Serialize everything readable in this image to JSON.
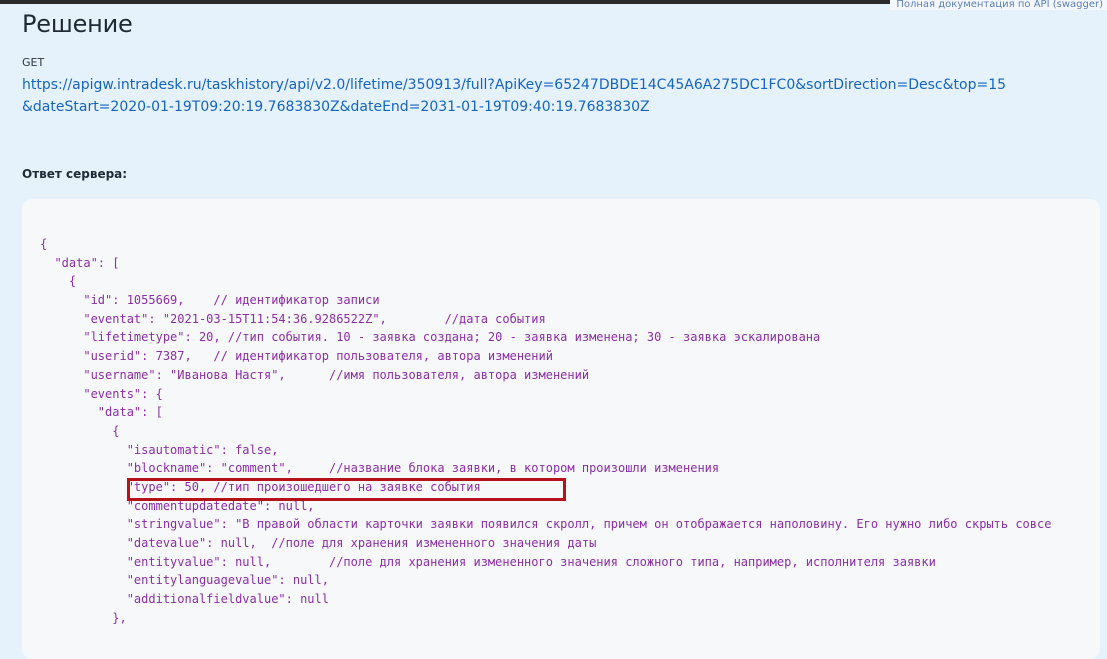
{
  "header": {
    "doc_link": "Полная документация по API (swagger)"
  },
  "section": {
    "title": "Решение",
    "method": "GET",
    "url": "https://apigw.intradesk.ru/taskhistory/api/v2.0/lifetime/350913/full?ApiKey=65247DBDE14C45A6A275DC1FC0&sortDirection=Desc&top=15&dateStart=2020-01-19T09:20:19.7683830Z&dateEnd=2031-01-19T09:40:19.7683830Z",
    "response_label": "Ответ сервера:"
  },
  "code": {
    "lines": [
      "{",
      "  \"data\": [",
      "    {",
      "      \"id\": 1055669,    // идентификатор записи",
      "      \"eventat\": \"2021-03-15T11:54:36.9286522Z\",        //дата события",
      "      \"lifetimetype\": 20, //тип события. 10 - заявка создана; 20 - заявка изменена; 30 - заявка эскалирована",
      "      \"userid\": 7387,   // идентификатор пользователя, автора изменений",
      "      \"username\": \"Иванова Настя\",      //имя пользователя, автора изменений",
      "      \"events\": {",
      "        \"data\": [",
      "          {",
      "            \"isautomatic\": false,",
      "            \"blockname\": \"comment\",     //название блока заявки, в котором произошли изменения",
      "            \"type\": 50, //тип произошедшего на заявке события",
      "            \"commentupdatedate\": null,",
      "            \"stringvalue\": \"В правой области карточки заявки появился скролл, причем он отображается наполовину. Его нужно либо скрыть совсе",
      "            \"datevalue\": null,  //поле для хранения измененного значения даты",
      "            \"entityvalue\": null,        //поле для хранения измененного значения сложного типа, например, исполнителя заявки",
      "            \"entitylanguagevalue\": null,",
      "            \"additionalfieldvalue\": null",
      "          },"
    ]
  }
}
